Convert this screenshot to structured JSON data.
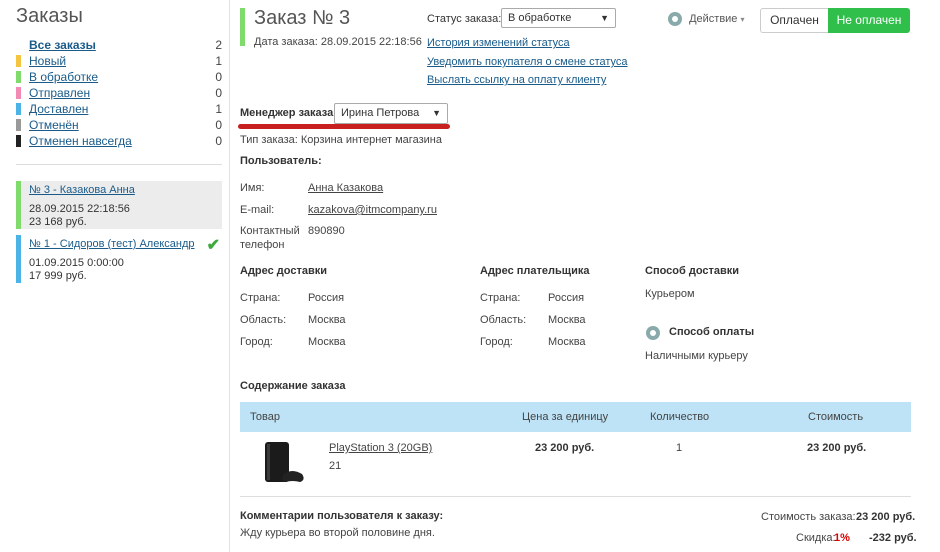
{
  "sidebar": {
    "title": "Заказы",
    "statuses": [
      {
        "label": "Все заказы",
        "count": "2",
        "color": ""
      },
      {
        "label": "Новый",
        "count": "1",
        "color": "#f5c542"
      },
      {
        "label": "В обработке",
        "count": "0",
        "color": "#7fdc6c"
      },
      {
        "label": "Отправлен",
        "count": "0",
        "color": "#f28ab3"
      },
      {
        "label": "Доставлен",
        "count": "1",
        "color": "#4bb3e6"
      },
      {
        "label": "Отменён",
        "count": "0",
        "color": "#999999"
      },
      {
        "label": "Отменен навсегда",
        "count": "0",
        "color": "#222222"
      }
    ],
    "orders": [
      {
        "title": "№ 3 - Казакова Анна",
        "date": "28.09.2015 22:18:56",
        "price": "23 168 руб.",
        "color": "#7fdc6c"
      },
      {
        "title": "№ 1 - Сидоров (тест) Александр",
        "date": "01.09.2015 0:00:00",
        "price": "17 999 руб.",
        "color": "#4bb3e6",
        "check": "✔"
      }
    ]
  },
  "order": {
    "title": "Заказ № 3",
    "date": "Дата заказа: 28.09.2015 22:18:56",
    "status_label": "Статус заказа:",
    "status_value": "В обработке",
    "links": [
      "История изменений статуса",
      "Уведомить покупателя о смене статуса",
      "Выслать ссылку на оплату клиенту"
    ],
    "action_label": "Действие",
    "paid_label": "Оплачен",
    "unpaid_label": "Не оплачен",
    "manager_label": "Менеджер заказа:",
    "manager_value": "Ирина Петрова",
    "order_type": "Тип заказа: Корзина интернет магазина",
    "user_heading": "Пользователь:",
    "user": {
      "name_label": "Имя:",
      "name": "Анна Казакова",
      "email_label": "E-mail:",
      "email": "kazakova@itmcompany.ru",
      "phone_label_1": "Контактный",
      "phone_label_2": "телефон",
      "phone": "890890"
    },
    "delivery": {
      "heading": "Адрес доставки",
      "country_label": "Страна:",
      "country": "Россия",
      "region_label": "Область:",
      "region": "Москва",
      "city_label": "Город:",
      "city": "Москва"
    },
    "payer": {
      "heading": "Адрес плательщика",
      "country_label": "Страна:",
      "country": "Россия",
      "region_label": "Область:",
      "region": "Москва",
      "city_label": "Город:",
      "city": "Москва"
    },
    "shipping_heading": "Способ доставки",
    "shipping_value": "Курьером",
    "payment_heading": "Способ оплаты",
    "payment_value": "Наличными курьеру",
    "content_heading": "Содержание заказа",
    "table": {
      "headers": [
        "Товар",
        "Цена за единицу",
        "Количество",
        "Стоимость"
      ],
      "row": {
        "name": "PlayStation 3 (20GB)",
        "sku": "21",
        "price": "23 200 руб.",
        "qty": "1",
        "total": "23 200 руб."
      }
    },
    "comment_heading": "Комментарии пользователя к заказу:",
    "comment": "Жду курьера во второй половине дня.",
    "summary": {
      "cost_label": "Стоимость заказа:",
      "cost": "23 200 руб.",
      "discount_label": "Скидка:",
      "discount_pct": "1%",
      "discount": "-232 руб."
    }
  }
}
